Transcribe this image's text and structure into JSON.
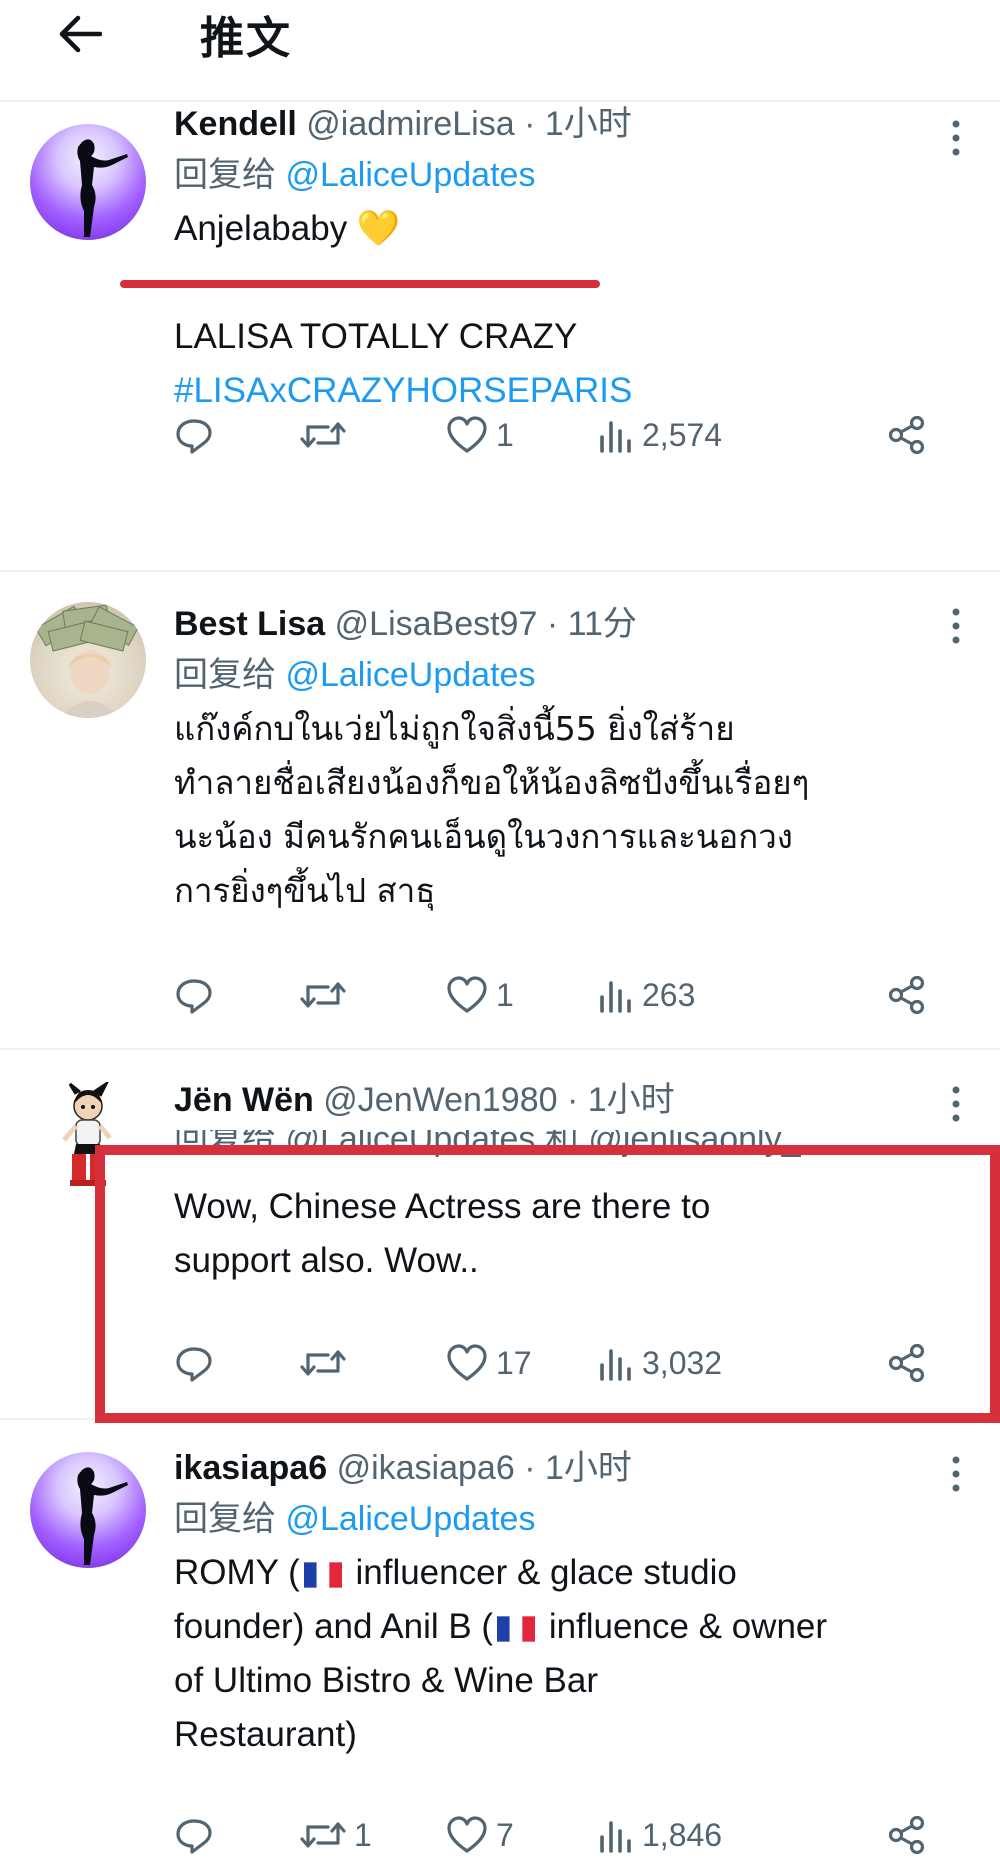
{
  "header": {
    "title": "推文"
  },
  "tweets": [
    {
      "name": "Kendell",
      "handle": "@iadmireLisa",
      "time": "· 1小时",
      "reply_prefix": "回复给",
      "reply_to": "@LaliceUpdates",
      "lines": [
        "Anjelababy 💛",
        "",
        "LALISA TOTALLY CRAZY"
      ],
      "hashtag": "#LISAxCRAZYHORSEPARIS",
      "likes": "1",
      "views": "2,574"
    },
    {
      "name": "Best Lisa",
      "handle": "@LisaBest97",
      "time": "· 11分",
      "reply_prefix": "回复给",
      "reply_to": "@LaliceUpdates",
      "lines": [
        "แก๊งค์กบในเว่ยไม่ถูกใจสิ่งนี้55 ยิ่งใส่ร้าย",
        "ทำลายชื่อเสียงน้องก็ขอให้น้องลิซปังขึ้นเรื่อยๆ",
        "นะน้อง มีคนรักคนเอ็นดูในวงการและนอกวง",
        "การยิ่งๆขึ้นไป สาธุ"
      ],
      "likes": "1",
      "views": "263"
    },
    {
      "name": "Jën Wën",
      "handle": "@JenWen1980",
      "time": "· 1小时",
      "reply_line": "回复给 @LaliceUpdates 和 @jenlisaonly_",
      "lines": [
        "Wow, Chinese Actress are there to",
        "support also. Wow.."
      ],
      "likes": "17",
      "views": "3,032"
    },
    {
      "name": "ikasiapa6",
      "handle": "@ikasiapa6",
      "time": "· 1小时",
      "reply_prefix": "回复给",
      "reply_to": "@LaliceUpdates",
      "line1_a": "ROMY (",
      "line1_b": " influencer & glace studio",
      "line2_a": "founder) and Anil B (",
      "line2_b": " influence & owner",
      "line3": "of Ultimo Bistro & Wine Bar",
      "line4": "Restaurant)",
      "retweets": "1",
      "likes": "7",
      "views": "1,846"
    }
  ],
  "colors": {
    "accent": "#1d9bf0",
    "annotation": "#d6303d",
    "muted": "#536471"
  },
  "icons": [
    "back-arrow-icon",
    "more-icon",
    "reply-icon",
    "retweet-icon",
    "heart-icon",
    "views-icon",
    "share-icon",
    "france-flag-icon"
  ]
}
